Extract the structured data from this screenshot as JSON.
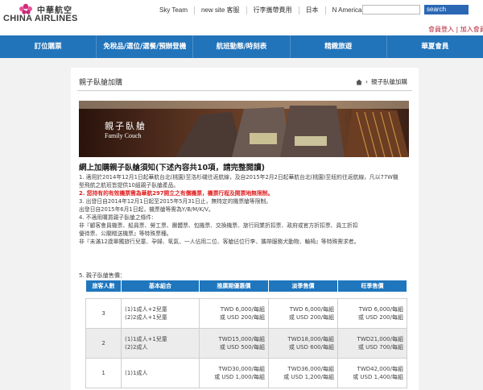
{
  "header": {
    "logo_zh": "中華航空",
    "logo_en": "CHINA AIRLINES",
    "top_links": [
      "Sky Team",
      "new site 客服",
      "行李攜帶費用",
      "日本",
      "N America"
    ],
    "search_label": "search",
    "member_link": "會員登入 | 加入會員"
  },
  "nav": {
    "items": [
      "訂位購票",
      "免稅品/選位/選餐/預辦登機",
      "航班動態/時刻表",
      "精緻旅遊",
      "華夏會員"
    ]
  },
  "page": {
    "title": "親子臥艙加購",
    "breadcrumb": "親子臥艙加購",
    "banner_title_zh": "親子臥艙",
    "banner_title_en": "Family Couch",
    "notice_title": "網上加購親子臥艙須知(下述內容共10項，請完整閱讀)",
    "notices": [
      "1. 適用於2014年12月1日起華航台北(桃園)至洛杉磯往返航線，及自2015年2月2日起華航台北(桃園)至紐約往返航線，凡以77W機",
      "    型飛航之航班皆提供10組親子臥艙產品。",
      "2. 您持有的有效機票需為華航297開立之有償機票，機票行程及開票地無限制。",
      "3. 出發日自2014年12月1日起至2015年5月31日止，無特定的機票艙等限制。",
      "    出發日自2015年6月1日起，機票艙等需為Y/B/M/K/V。",
      "4. 不適用購買親子臥艙之條件:",
      "    非『顧客會員機票、船員票、勞工票、團體票、包機票、交換機票、旅行同業折扣票、政府或官方折扣票、員工折扣",
      "    優待票、公關贈送機票』等特殊票種。",
      "    非『未滿12歲單獨旅行兒童、孕婦、氧氣、一人佔用二位、客艙佔位行李、攜帶服務犬動物、輪椅』等特殊需求者。"
    ],
    "fees_label": "5. 親子臥艙售價："
  },
  "table": {
    "headers": [
      "旅客人數",
      "基本組合",
      "推廣期優惠價",
      "淡季售價",
      "旺季售價"
    ],
    "rows": [
      {
        "count": "3",
        "combos": [
          "(1)1成人+2兒童",
          "(2)2成人+1兒童"
        ],
        "promo": [
          "TWD  6,000/每組",
          "或 USD     200/每組"
        ],
        "low": [
          "TWD  6,000/每組",
          "或 USD     200/每組"
        ],
        "high": [
          "TWD  6,000/每組",
          "或 USD     200/每組"
        ]
      },
      {
        "count": "2",
        "combos": [
          "(1)1成人+1兒童",
          "(2)2成人"
        ],
        "promo": [
          "TWD15,000/每組",
          "或 USD     500/每組"
        ],
        "low": [
          "TWD18,000/每組",
          "或 USD     600/每組"
        ],
        "high": [
          "TWD21,000/每組",
          "或 USD     700/每組"
        ]
      },
      {
        "count": "1",
        "combos": [
          "(1)1成人"
        ],
        "promo": [
          "TWD30,000/每組",
          "或 USD  1,000/每組"
        ],
        "low": [
          "TWD36,000/每組",
          "或 USD  1,200/每組"
        ],
        "high": [
          "TWD42,000/每組",
          "或 USD  1,400/每組"
        ]
      }
    ]
  },
  "colors": {
    "nav_blue": "#2174ba",
    "table_header": "#1f76bd",
    "accent_red": "#e02020",
    "brand_pink": "#c8267a"
  }
}
